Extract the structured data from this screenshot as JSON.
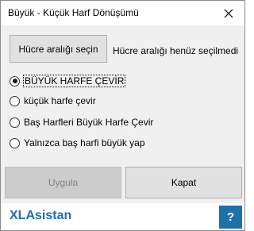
{
  "window": {
    "title": "Büyük - Küçük Harf Dönüşümü"
  },
  "range": {
    "button_label": "Hücre aralığı seçin",
    "status_text": "Hücre aralığı henüz seçilmedi"
  },
  "options": [
    {
      "label": "BÜYÜK HARFE ÇEVİR",
      "checked": true
    },
    {
      "label": "küçük harfe çevir",
      "checked": false
    },
    {
      "label": "Baş Harfleri Büyük Harfe Çevir",
      "checked": false
    },
    {
      "label": "Yalnızca baş harfi büyük yap",
      "checked": false
    }
  ],
  "actions": {
    "apply_label": "Uygula",
    "apply_enabled": false,
    "close_label": "Kapat"
  },
  "footer": {
    "brand": "XLAsistan",
    "help_label": "?"
  },
  "colors": {
    "brand": "#1f70a8",
    "dialog_background": "#f0f0f0"
  }
}
